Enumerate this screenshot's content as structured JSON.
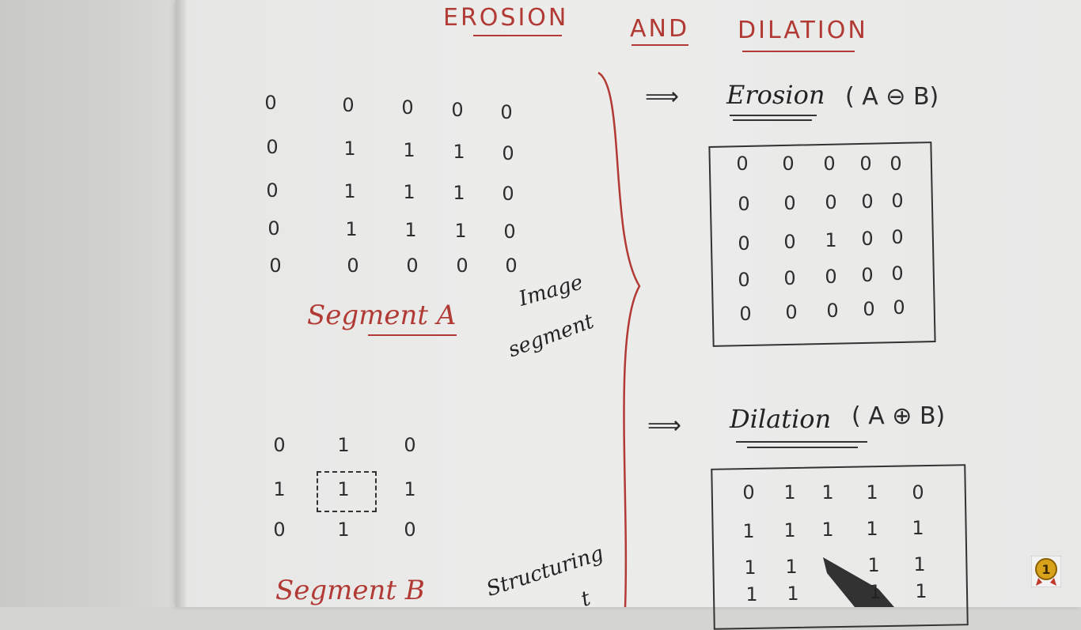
{
  "title": {
    "erosion": "EROSION",
    "and": "AND",
    "dilation": "DILATION"
  },
  "segment_a": {
    "label": "Segment A",
    "note_line1": "Image",
    "note_line2": "segment",
    "matrix": [
      [
        "0",
        "0",
        "0",
        "0",
        "0"
      ],
      [
        "0",
        "1",
        "1",
        "1",
        "0"
      ],
      [
        "0",
        "1",
        "1",
        "1",
        "0"
      ],
      [
        "0",
        "1",
        "1",
        "1",
        "0"
      ],
      [
        "0",
        "0",
        "0",
        "0",
        "0"
      ]
    ]
  },
  "segment_b": {
    "label": "Segment B",
    "note": "Structuring",
    "note2": "t",
    "matrix": [
      [
        "0",
        "1",
        "0"
      ],
      [
        "1",
        "1",
        "1"
      ],
      [
        "0",
        "1",
        "0"
      ]
    ]
  },
  "erosion": {
    "arrow": "⟹",
    "heading": "Erosion",
    "formula": "( A ⊖ B)",
    "matrix": [
      [
        "0",
        "0",
        "0",
        "0",
        "0"
      ],
      [
        "0",
        "0",
        "0",
        "0",
        "0"
      ],
      [
        "0",
        "0",
        "1",
        "0",
        "0"
      ],
      [
        "0",
        "0",
        "0",
        "0",
        "0"
      ],
      [
        "0",
        "0",
        "0",
        "0",
        "0"
      ]
    ]
  },
  "dilation": {
    "arrow": "⟹",
    "heading": "Dilation",
    "formula": "( A ⊕ B)",
    "matrix": [
      [
        "0",
        "1",
        "1",
        "1",
        "0"
      ],
      [
        "1",
        "1",
        "1",
        "1",
        "1"
      ],
      [
        "1",
        "1",
        "",
        "1",
        "1"
      ],
      [
        "1",
        "1",
        "",
        "1",
        "1"
      ]
    ]
  },
  "badge": {
    "text": "1",
    "color": "#d9a21b"
  }
}
